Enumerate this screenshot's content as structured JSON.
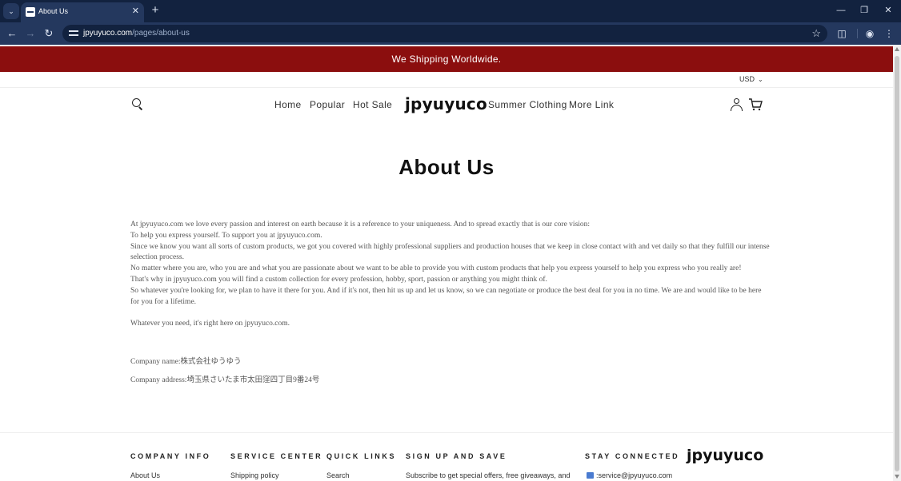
{
  "browser": {
    "tab_title": "About Us",
    "tab_close": "✕",
    "new_tab": "+",
    "url_domain": "jpyuyuco.com",
    "url_path": "/pages/about-us",
    "icons": [
      "tab-search-icon",
      "back-icon",
      "forward-icon",
      "reload-icon",
      "site-info-icon",
      "star-icon",
      "extensions-icon",
      "profile-icon",
      "menu-icon",
      "minimize-icon",
      "restore-icon",
      "close-icon"
    ]
  },
  "announcement": "We Shipping Worldwide.",
  "currency": "USD",
  "nav": {
    "items": [
      "Home",
      "Popular",
      "Hot Sale",
      "Summer Clothing",
      "More Link"
    ],
    "logo": "jpyuyuco"
  },
  "page_title": "About Us",
  "body": {
    "paragraphs": [
      "At jpyuyuco.com we love every passion and interest on earth because it is a reference to your uniqueness. And to spread exactly that is our core vision:",
      "To help you express yourself. To support you at jpyuyuco.com.",
      "Since we know you want all sorts of custom products, we got you covered with highly professional suppliers and production houses that we keep in close contact with and vet daily so that they fulfill our intense selection process.",
      "No matter where you are, who you are and what you are passionate about we want to be able to provide you with custom products that help you express yourself to help you express who you really are!",
      "That's why in jpyuyuco.com you will find a custom collection for every profession, hobby, sport, passion or anything you might think of.",
      "So whatever you're looking for, we plan to have it there for you. And if it's not, then hit us up and let us know, so we can negotiate or produce the best deal for you in no time. We are and would like to be here for you for a lifetime."
    ],
    "closing": "Whatever you need, it's right here on jpyuyuco.com.",
    "company_name": "Company name:株式会社ゆうゆう",
    "company_address": "Company address:埼玉県さいたま市太田窪四丁目9番24号"
  },
  "footer": {
    "headings": [
      "COMPANY INFO",
      "SERVICE CENTER",
      "QUICK LINKS",
      "SIGN UP AND SAVE",
      "STAY CONNECTED"
    ],
    "links": [
      "About Us",
      "Shipping policy",
      "Search",
      "Subscribe to get special offers, free giveaways, and",
      ":service@jpyuyuco.com"
    ],
    "logo": "jpyuyuco"
  },
  "colors": {
    "announcement_bg": "#8b0e0e",
    "chrome_dark": "#12223f",
    "chrome_toolbar": "#24385e"
  }
}
